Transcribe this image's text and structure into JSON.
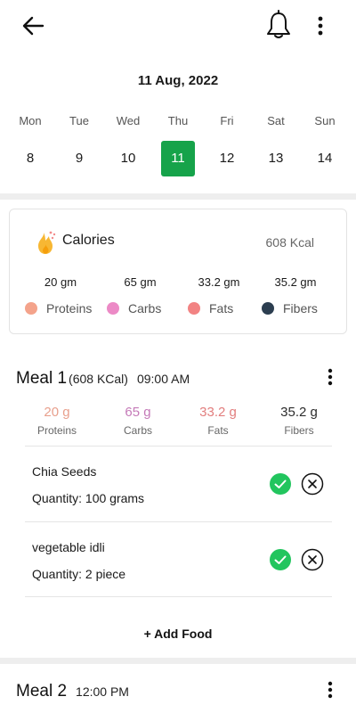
{
  "header": {
    "back_icon": "arrow-left-icon",
    "bell_icon": "bell-icon",
    "more_icon": "more-vertical-icon"
  },
  "date_title": "11 Aug, 2022",
  "week": [
    {
      "name": "Mon",
      "num": "8",
      "selected": false
    },
    {
      "name": "Tue",
      "num": "9",
      "selected": false
    },
    {
      "name": "Wed",
      "num": "10",
      "selected": false
    },
    {
      "name": "Thu",
      "num": "11",
      "selected": true
    },
    {
      "name": "Fri",
      "num": "12",
      "selected": false
    },
    {
      "name": "Sat",
      "num": "13",
      "selected": false
    },
    {
      "name": "Sun",
      "num": "14",
      "selected": false
    }
  ],
  "calories_card": {
    "icon": "fire-icon",
    "label": "Calories",
    "value": "608 Kcal",
    "macros": [
      {
        "value": "20 gm",
        "name": "Proteins",
        "color": "#f4a38b"
      },
      {
        "value": "65 gm",
        "name": "Carbs",
        "color": "#ec8ac6"
      },
      {
        "value": "33.2 gm",
        "name": "Fats",
        "color": "#f28383"
      },
      {
        "value": "35.2 gm",
        "name": "Fibers",
        "color": "#2c3e50"
      }
    ]
  },
  "meal1": {
    "title": "Meal 1",
    "kcal": "(608 KCal)",
    "time": "09:00 AM",
    "stats": [
      {
        "value": "20 g",
        "label": "Proteins",
        "color": "#e8a08d"
      },
      {
        "value": "65 g",
        "label": "Carbs",
        "color": "#c57ab8"
      },
      {
        "value": "33.2 g",
        "label": "Fats",
        "color": "#e27e7e"
      },
      {
        "value": "35.2 g",
        "label": "Fibers",
        "color": "#2c2c2c"
      }
    ],
    "foods": [
      {
        "name": "Chia Seeds",
        "quantity": "Quantity: 100 grams"
      },
      {
        "name": "vegetable idli",
        "quantity": "Quantity: 2 piece"
      }
    ],
    "add_food_label": "+ Add Food"
  },
  "meal2": {
    "title": "Meal 2",
    "time": "12:00 PM"
  },
  "colors": {
    "accent_green": "#16a34a",
    "check_green": "#22c55e",
    "divider": "#eeeeee"
  }
}
